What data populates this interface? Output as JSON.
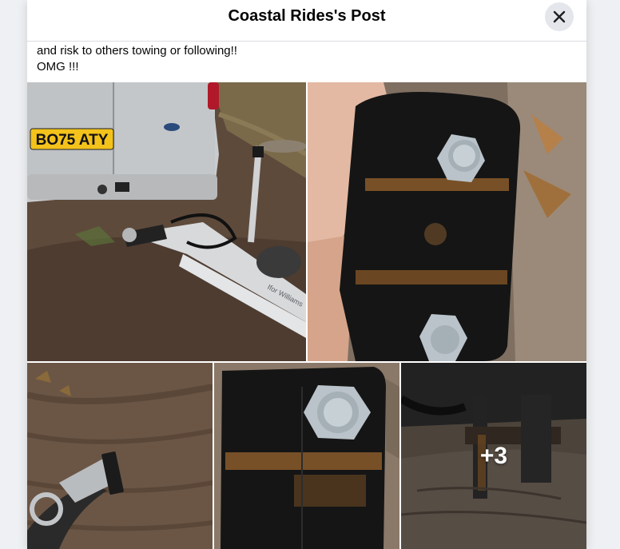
{
  "dialog": {
    "title": "Coastal Rides's Post",
    "close_icon": "close-icon"
  },
  "post": {
    "text_lines": [
      "and risk to others towing or following!!",
      "OMG !!!"
    ]
  },
  "photos": {
    "plate_text": "BO75 ATY",
    "trailer_brand": "Ifor Williams",
    "more_count_label": "+3",
    "colors": {
      "van": "#c9cccf",
      "plate": "#f3c21b",
      "mud": "#6b5646",
      "plate_metal": "#151515",
      "rust": "#8a5a2a",
      "bolt": "#b9c3c9"
    }
  }
}
